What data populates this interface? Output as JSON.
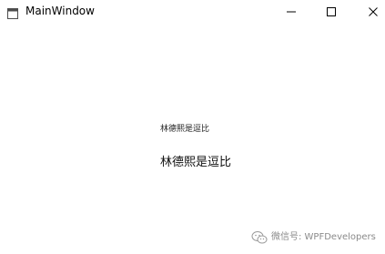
{
  "window": {
    "title": "MainWindow"
  },
  "content": {
    "small_text": "林德熙是逗比",
    "large_text": "林德熙是逗比"
  },
  "watermark": {
    "text": "微信号: WPFDevelopers"
  },
  "icons": {
    "app": "window-icon",
    "minimize": "minimize-icon",
    "maximize": "maximize-icon",
    "close": "close-icon",
    "watermark": "wechat-icon"
  }
}
